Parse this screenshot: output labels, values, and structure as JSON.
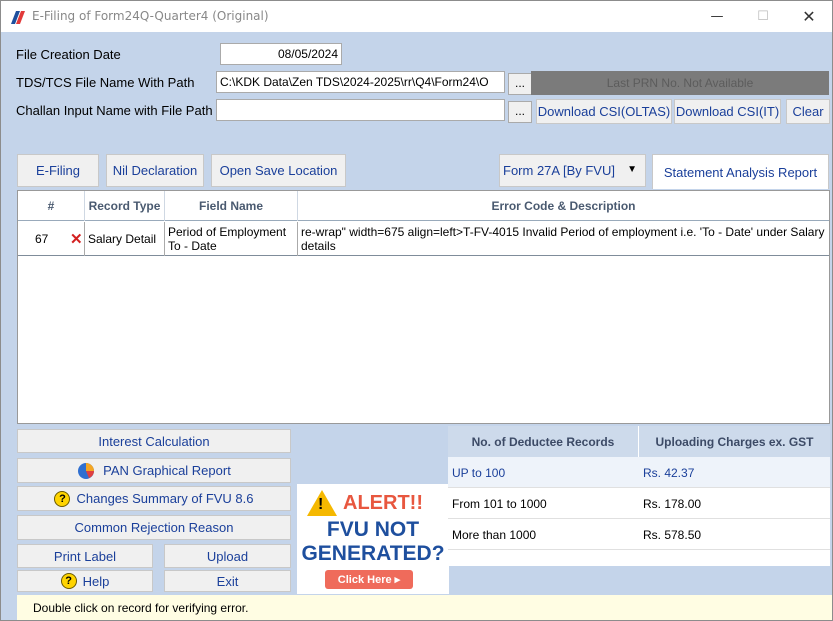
{
  "window": {
    "title": "E-Filing of Form24Q-Quarter4 (Original)",
    "minimize": "—",
    "maximize": "☐",
    "close": "✕"
  },
  "form": {
    "file_creation_date_label": "File Creation Date",
    "file_creation_date_value": "08/05/2024",
    "tds_file_label": "TDS/TCS File Name With Path",
    "tds_file_value": "C:\\KDK Data\\Zen TDS\\2024-2025\\rr\\Q4\\Form24\\O",
    "challan_label": "Challan Input Name with File Path",
    "challan_value": "",
    "browse_label": "...",
    "last_prn": "Last PRN No. Not Available",
    "download_oltas": "Download CSI(OLTAS)",
    "download_it": "Download CSI(IT)",
    "clear": "Clear"
  },
  "toolbar": {
    "efiling": "E-Filing",
    "nil_declaration": "Nil Declaration",
    "open_save_location": "Open Save Location",
    "form_select": "Form 27A [By FVU]",
    "statement_analysis": "Statement Analysis Report"
  },
  "grid": {
    "headers": {
      "num": "#",
      "record_type": "Record Type",
      "field_name": "Field Name",
      "error": "Error Code & Description"
    },
    "rows": [
      {
        "num": "67",
        "record_type": "Salary Detail",
        "field_name": "Period of Employment To - Date",
        "error": "re-wrap\" width=675 align=left>T-FV-4015 Invalid Period of employment i.e. 'To - Date' under Salary details"
      }
    ]
  },
  "actions": {
    "interest_calculation": "Interest Calculation",
    "pan_graphical_report": "PAN Graphical Report",
    "changes_summary": "Changes Summary of FVU 8.6",
    "common_rejection": "Common Rejection Reason",
    "print_label": "Print Label",
    "upload": "Upload",
    "help": "Help",
    "exit": "Exit"
  },
  "alert": {
    "title": "ALERT!!",
    "line1": "FVU NOT",
    "line2": "GENERATED?",
    "click": "Click Here ▸"
  },
  "charges": {
    "headers": {
      "records": "No. of Deductee Records",
      "charges": "Uploading Charges ex. GST"
    },
    "rows": [
      {
        "range": "UP to 100",
        "amount": "Rs. 42.37"
      },
      {
        "range": "From 101 to 1000",
        "amount": "Rs. 178.00"
      },
      {
        "range": "More than 1000",
        "amount": "Rs. 578.50"
      }
    ]
  },
  "status": {
    "message": "Double click on record for verifying error."
  },
  "colors": {
    "accent": "#1a3f9a",
    "background": "#c4d4ea",
    "alert_red": "#e8573f",
    "alert_blue": "#1e4f9e"
  }
}
